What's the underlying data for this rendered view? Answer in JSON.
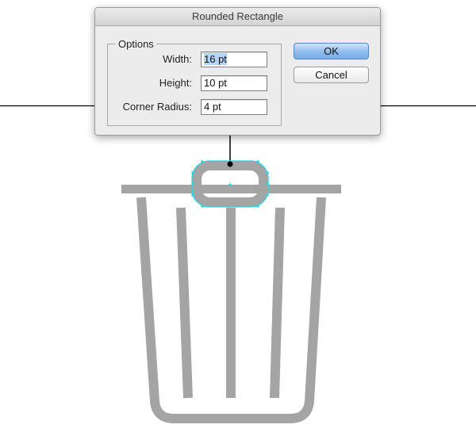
{
  "dialog": {
    "title": "Rounded Rectangle",
    "group_label": "Options",
    "fields": [
      {
        "label": "Width:",
        "value": "16 pt"
      },
      {
        "label": "Height:",
        "value": "10 pt"
      },
      {
        "label": "Corner Radius:",
        "value": "4 pt"
      }
    ],
    "ok_label": "OK",
    "cancel_label": "Cancel"
  },
  "artwork": {
    "icon": "trash-can-icon",
    "icon_color": "#a4a4a4",
    "selection_color": "#29d4e0",
    "guide_color": "#000000"
  }
}
